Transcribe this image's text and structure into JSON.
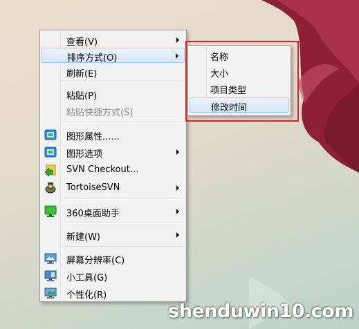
{
  "context_menu": {
    "items": [
      {
        "label": "查看(V)",
        "has_submenu": true
      },
      {
        "label": "排序方式(O)",
        "has_submenu": true,
        "highlighted": true
      },
      {
        "label": "刷新(E)"
      },
      {
        "label": "粘贴(P)"
      },
      {
        "label": "粘贴快捷方式(S)",
        "disabled": true
      },
      {
        "label": "图形属性......",
        "icon": "graphics-properties-icon"
      },
      {
        "label": "图形选项",
        "icon": "graphics-options-icon",
        "has_submenu": true
      },
      {
        "label": "SVN Checkout...",
        "icon": "svn-checkout-icon"
      },
      {
        "label": "TortoiseSVN",
        "icon": "tortoisesvn-icon",
        "has_submenu": true
      },
      {
        "label": "360桌面助手",
        "icon": "360-desktop-icon",
        "has_submenu": true
      },
      {
        "label": "新建(W)",
        "has_submenu": true
      },
      {
        "label": "屏幕分辨率(C)",
        "icon": "screen-resolution-icon"
      },
      {
        "label": "小工具(G)",
        "icon": "gadgets-icon"
      },
      {
        "label": "个性化(R)",
        "icon": "personalize-icon"
      }
    ]
  },
  "sort_submenu": {
    "items": [
      {
        "label": "名称"
      },
      {
        "label": "大小"
      },
      {
        "label": "项目类型"
      },
      {
        "label": "修改时间",
        "highlighted": true
      }
    ]
  },
  "watermark": {
    "text": "shenduwin10.com"
  },
  "colors": {
    "highlight_border": "#a8c6ee",
    "annotation_box": "#e02020",
    "menu_bg": "#f2f2f2"
  }
}
